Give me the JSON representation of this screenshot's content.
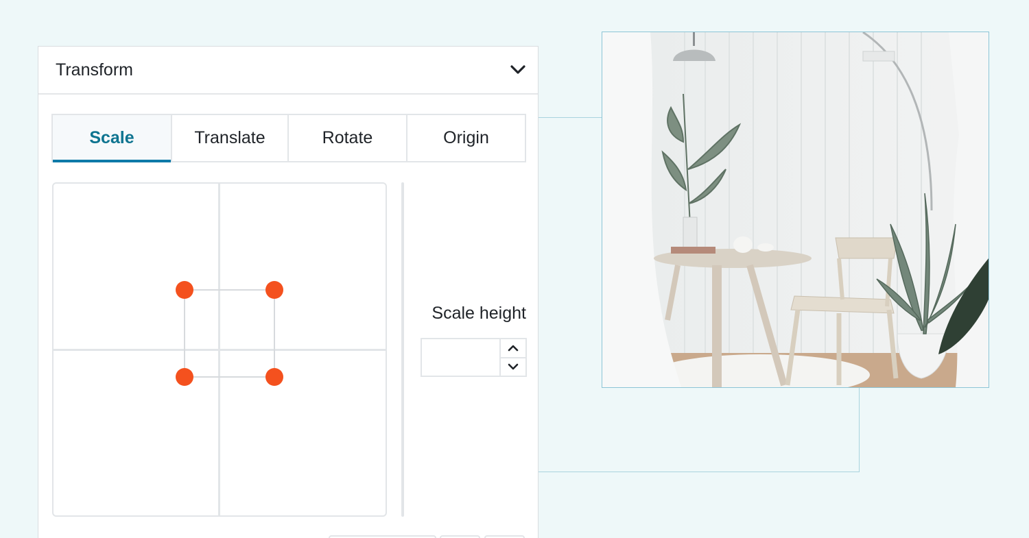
{
  "panel": {
    "title": "Transform",
    "tabs": [
      {
        "label": "Scale",
        "active": true
      },
      {
        "label": "Translate",
        "active": false
      },
      {
        "label": "Rotate",
        "active": false
      },
      {
        "label": "Origin",
        "active": false
      }
    ],
    "scale_height": {
      "label": "Scale height",
      "value": ""
    }
  },
  "colors": {
    "accent": "#0e7490",
    "handle": "#f4511e",
    "guide": "#a9d3de"
  },
  "icons": {
    "collapse": "chevron-down-icon",
    "increment": "chevron-up-icon",
    "decrement": "chevron-down-icon"
  }
}
